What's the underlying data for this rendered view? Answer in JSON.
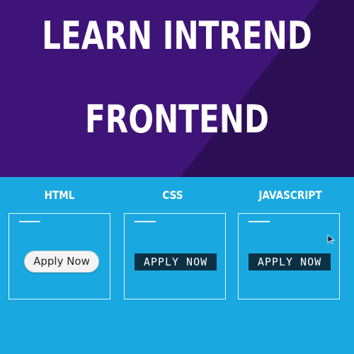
{
  "banner": {
    "line1": "LEARN INTREND",
    "line2": "FRONTEND",
    "colors": {
      "primary": "#3f1478",
      "secondary": "#2c0e55",
      "text": "#ffffff"
    }
  },
  "demos": {
    "background": "#1aa8e0",
    "columns": [
      {
        "label": "HTML",
        "button_label": "Apply Now"
      },
      {
        "label": "CSS",
        "button_label": "APPLY NOW"
      },
      {
        "label": "JAVASCRIPT",
        "button_label": "APPLY NOW"
      }
    ]
  },
  "cursor": {
    "icon": "mouse-pointer-icon"
  }
}
